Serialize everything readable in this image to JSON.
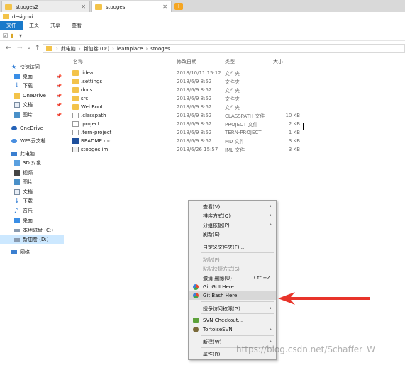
{
  "window": {
    "tabs": [
      {
        "label": "stooges2",
        "active": false
      },
      {
        "label": "stooges",
        "active": true
      }
    ],
    "title": "designui"
  },
  "ribbon": {
    "tabs": [
      "文件",
      "主页",
      "共享",
      "查看"
    ]
  },
  "address": {
    "path": [
      "此电脑",
      "新加卷 (D:)",
      "learnplace",
      "stooges"
    ]
  },
  "sidebar": {
    "items": [
      {
        "label": "快速访问",
        "icon": "star-icon",
        "pinned": false
      },
      {
        "label": "桌面",
        "icon": "desktop-icon",
        "pinned": true
      },
      {
        "label": "下载",
        "icon": "download-icon",
        "pinned": true
      },
      {
        "label": "OneDrive",
        "icon": "folder-icon",
        "pinned": true
      },
      {
        "label": "文档",
        "icon": "document-icon",
        "pinned": true
      },
      {
        "label": "图片",
        "icon": "picture-icon",
        "pinned": true
      },
      {
        "label": "OneDrive",
        "icon": "cloud-icon",
        "pinned": false
      },
      {
        "label": "WPS云文档",
        "icon": "wps-cloud-icon",
        "pinned": false
      },
      {
        "label": "此电脑",
        "icon": "computer-icon",
        "pinned": false
      },
      {
        "label": "3D 对象",
        "icon": "cube-icon",
        "pinned": false
      },
      {
        "label": "视频",
        "icon": "video-icon",
        "pinned": false
      },
      {
        "label": "图片",
        "icon": "picture-icon",
        "pinned": false
      },
      {
        "label": "文档",
        "icon": "document-icon",
        "pinned": false
      },
      {
        "label": "下载",
        "icon": "download-icon",
        "pinned": false
      },
      {
        "label": "音乐",
        "icon": "music-icon",
        "pinned": false
      },
      {
        "label": "桌面",
        "icon": "desktop-icon",
        "pinned": false
      },
      {
        "label": "本地磁盘 (C:)",
        "icon": "drive-icon",
        "pinned": false
      },
      {
        "label": "新加卷 (D:)",
        "icon": "drive-icon",
        "pinned": false,
        "selected": true
      },
      {
        "label": "网络",
        "icon": "network-icon",
        "pinned": false
      }
    ]
  },
  "filelist": {
    "columns": {
      "name": "名称",
      "date": "修改日期",
      "type": "类型",
      "size": "大小"
    },
    "rows": [
      {
        "name": ".idea",
        "date": "2018/10/11 15:12",
        "type": "文件夹",
        "size": "",
        "icon": "folder"
      },
      {
        "name": ".settings",
        "date": "2018/6/9 8:52",
        "type": "文件夹",
        "size": "",
        "icon": "folder"
      },
      {
        "name": "docs",
        "date": "2018/6/9 8:52",
        "type": "文件夹",
        "size": "",
        "icon": "folder"
      },
      {
        "name": "src",
        "date": "2018/6/9 8:52",
        "type": "文件夹",
        "size": "",
        "icon": "folder"
      },
      {
        "name": "WebRoot",
        "date": "2018/6/9 8:52",
        "type": "文件夹",
        "size": "",
        "icon": "folder"
      },
      {
        "name": ".classpath",
        "date": "2018/6/9 8:52",
        "type": "CLASSPATH 文件",
        "size": "10 KB",
        "icon": "doc"
      },
      {
        "name": ".project",
        "date": "2018/6/9 8:52",
        "type": "PROJECT 文件",
        "size": "2 KB",
        "icon": "doc"
      },
      {
        "name": ".tern-project",
        "date": "2018/6/9 8:52",
        "type": "TERN-PROJECT",
        "size": "1 KB",
        "icon": "doc"
      },
      {
        "name": "README.md",
        "date": "2018/6/9 8:52",
        "type": "MD 文件",
        "size": "3 KB",
        "icon": "md"
      },
      {
        "name": "stooges.iml",
        "date": "2018/6/26 15:57",
        "type": "IML 文件",
        "size": "3 KB",
        "icon": "iml"
      }
    ]
  },
  "context_menu": {
    "items": [
      {
        "label": "查看(V)",
        "submenu": true
      },
      {
        "label": "排序方式(O)",
        "submenu": true
      },
      {
        "label": "分组依据(P)",
        "submenu": true
      },
      {
        "label": "刷新(E)"
      },
      {
        "separator": true
      },
      {
        "label": "自定义文件夹(F)..."
      },
      {
        "separator": true
      },
      {
        "label": "粘贴(P)",
        "disabled": true
      },
      {
        "label": "粘贴快捷方式(S)",
        "disabled": true
      },
      {
        "label": "撤消 删除(U)",
        "shortcut": "Ctrl+Z"
      },
      {
        "label": "Git GUI Here",
        "icon": "git-gui-icon"
      },
      {
        "label": "Git Bash Here",
        "icon": "git-bash-icon",
        "highlighted": true
      },
      {
        "separator": true
      },
      {
        "label": "授予访问权限(G)",
        "submenu": true
      },
      {
        "separator": true
      },
      {
        "label": "SVN Checkout...",
        "icon": "svn-icon"
      },
      {
        "label": "TortoiseSVN",
        "icon": "tortoise-icon",
        "submenu": true
      },
      {
        "separator": true
      },
      {
        "label": "新建(W)",
        "submenu": true
      },
      {
        "separator": true
      },
      {
        "label": "属性(R)"
      }
    ]
  },
  "watermark": "https://blog.csdn.net/Schaffer_W",
  "colors": {
    "accent": "#1979ca",
    "folder": "#f3c34a",
    "arrow": "#e8342a"
  }
}
